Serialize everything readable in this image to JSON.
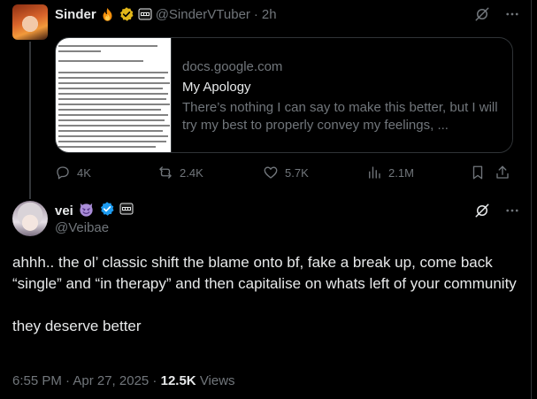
{
  "parent_tweet": {
    "display_name": "Sinder",
    "handle": "@SinderVTuber",
    "separator": "·",
    "time": "2h",
    "card": {
      "domain": "docs.google.com",
      "title": "My Apology",
      "description": "There’s nothing I can say to make this better, but I will try my best to properly convey my feelings, ..."
    },
    "actions": {
      "replies": "4K",
      "reposts": "2.4K",
      "likes": "5.7K",
      "views": "2.1M"
    }
  },
  "main_tweet": {
    "display_name": "vei",
    "handle": "@Veibae",
    "text_paragraph_1": "ahhh.. the ol’ classic shift the blame onto bf, fake a break up, come back “single” and “in therapy” and then capitalise on whats left of your community",
    "text_paragraph_2": "they deserve better",
    "timestamp": "6:55 PM · Apr 27, 2025 ·",
    "views_count": "12.5K",
    "views_label": "Views"
  },
  "colors": {
    "background": "#000000",
    "text_primary": "#e7e9ea",
    "text_muted": "#71767b",
    "border": "#2f3336",
    "verified_gold": "#e2b719",
    "verified_blue": "#1d9bf0"
  },
  "icons": {
    "fire_emoji": "fire-icon",
    "devil_emoji": "smiling-devil-icon",
    "verified_gold": "verified-gold-icon",
    "verified_blue": "verified-blue-icon",
    "affiliate_badge": "affiliate-badge-icon",
    "grok": "grok-icon",
    "more": "more-icon",
    "reply": "reply-icon",
    "repost": "repost-icon",
    "like": "heart-icon",
    "views": "views-chart-icon",
    "bookmark": "bookmark-icon",
    "share": "share-icon"
  }
}
